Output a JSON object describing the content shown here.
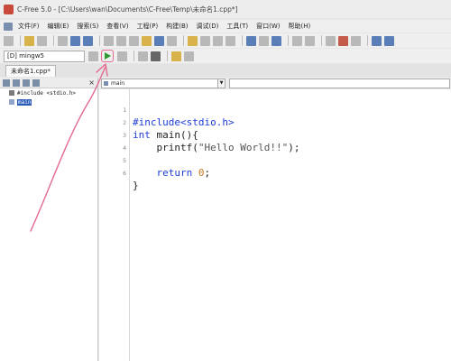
{
  "window": {
    "title": "C-Free 5.0 - [C:\\Users\\wan\\Documents\\C-Free\\Temp\\未命名1.cpp*]"
  },
  "menu": {
    "items": [
      "文件(F)",
      "编辑(E)",
      "搜索(S)",
      "查看(V)",
      "工程(P)",
      "构建(B)",
      "调试(D)",
      "工具(T)",
      "窗口(W)",
      "帮助(H)"
    ]
  },
  "toolbar": {
    "compiler": "[D] mingw5",
    "run_icon": "play-icon"
  },
  "tabs": {
    "file": "未命名1.cpp*"
  },
  "outline": {
    "items": [
      {
        "label": "#include <stdio.h>",
        "icon": "include-icon"
      },
      {
        "label": "main",
        "icon": "function-icon",
        "selected": true
      }
    ]
  },
  "editor": {
    "function_select": "main",
    "lines": [
      {
        "n": "1"
      },
      {
        "n": "2"
      },
      {
        "n": "3"
      },
      {
        "n": "4"
      },
      {
        "n": "5"
      },
      {
        "n": "6"
      }
    ]
  },
  "colors": {
    "keyword": "#1e3ed6",
    "number": "#c8781e",
    "annotation": "#e46a8e",
    "run": "#2f9a2f"
  }
}
